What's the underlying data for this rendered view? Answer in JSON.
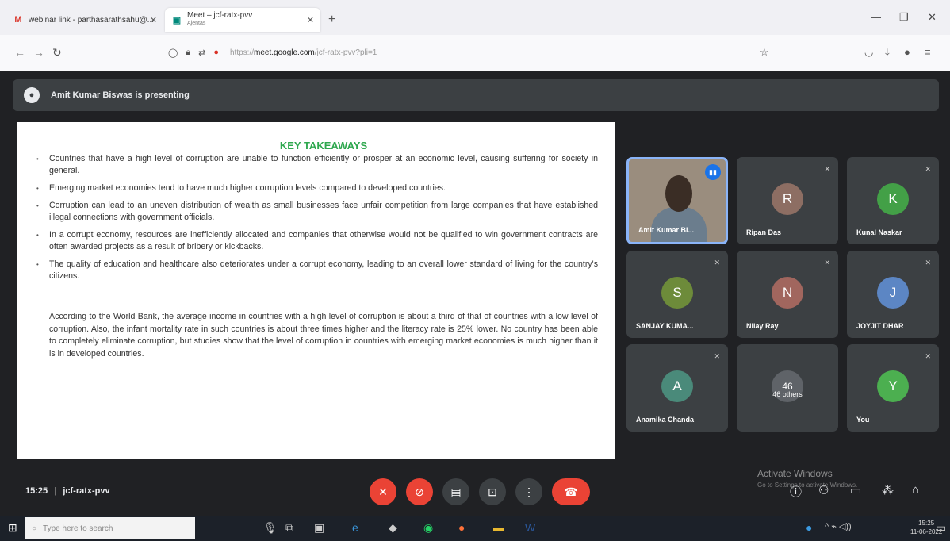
{
  "browser": {
    "tab1_title": "webinar link - parthasarathsahu@...",
    "tab2_title": "Meet – jcf-ratx-pvv",
    "tab2_sub": "Ajentas",
    "url_host": "meet.google.com",
    "url_prefix": "https://",
    "url_suffix": "/jcf-ratx-pvv?pli=1"
  },
  "meet": {
    "presenting": "Amit Kumar Biswas is presenting",
    "time": "15:25",
    "separator": "|",
    "meeting_code": "jcf-ratx-pvv"
  },
  "slide": {
    "title": "KEY TAKEAWAYS",
    "bullets": [
      "Countries that have a high level of corruption are unable to function efficiently or prosper at an economic level, causing suffering for society in general.",
      "Emerging market economies tend to have much higher corruption levels compared to developed countries.",
      "Corruption can lead to an uneven distribution of wealth as small businesses face unfair competition from large companies that have established illegal connections with government officials.",
      "In a corrupt economy, resources are inefficiently allocated and companies that otherwise would not be qualified to win government contracts are often awarded projects as a result of bribery or kickbacks.",
      "The quality of education and healthcare also deteriorates under a corrupt economy, leading to an overall lower standard of living for the country's citizens."
    ],
    "paragraph": "According to the World Bank, the average income in countries with a high level of corruption is about a third of that of countries with a low level of corruption. Also, the infant mortality rate in such countries is about three times higher and the literacy rate is 25% lower. No country has been able to completely eliminate corruption, but studies show that the level of corruption in countries with emerging market economies is much higher than it is in developed countries."
  },
  "participants": [
    {
      "name": "Amit Kumar Bi...",
      "avatar": "",
      "color": "#9a8d7e"
    },
    {
      "name": "Ripan Das",
      "avatar": "R",
      "color": "#8d6e63"
    },
    {
      "name": "Kunal Naskar",
      "avatar": "K",
      "color": "#43a047"
    },
    {
      "name": "SANJAY KUMA...",
      "avatar": "S",
      "color": "#6d8b3a"
    },
    {
      "name": "Nilay Ray",
      "avatar": "N",
      "color": "#a1665e"
    },
    {
      "name": "JOYJIT DHAR",
      "avatar": "J",
      "color": "#5c86c4"
    },
    {
      "name": "Anamika Chanda",
      "avatar": "A",
      "color": "#4a8a7a"
    },
    {
      "name": "46 others",
      "avatar": "46",
      "color": "#5f6368"
    },
    {
      "name": "You",
      "avatar": "Y",
      "color": "#4caf50"
    }
  ],
  "watermark": {
    "line1": "Activate Windows",
    "line2": "Go to Settings to activate Windows."
  },
  "taskbar": {
    "search_placeholder": "Type here to search",
    "time": "15:25",
    "date": "11-06-2022"
  },
  "colors": {
    "meet_bg": "#202124",
    "tile_bg": "#3c4043",
    "hangup": "#ea4335",
    "slide_title": "#2fa84f"
  }
}
